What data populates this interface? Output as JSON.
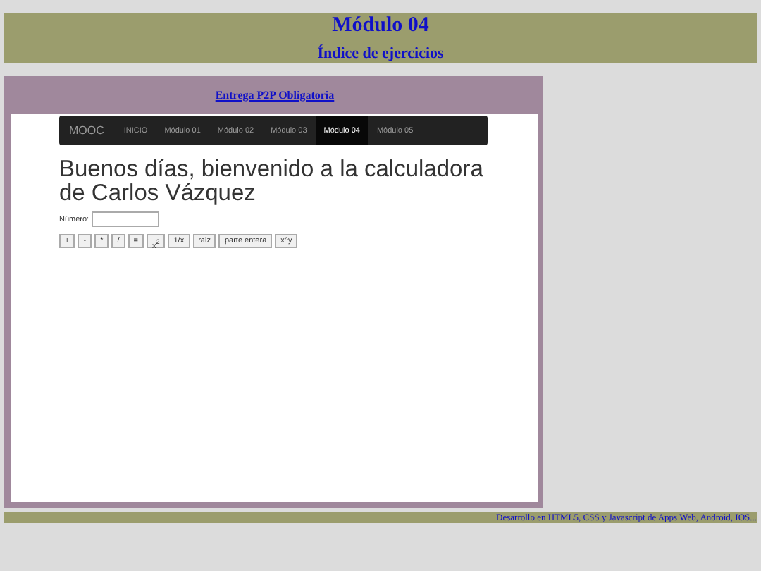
{
  "header": {
    "title": "Módulo 04",
    "subtitle": "Índice de ejercicios"
  },
  "panel": {
    "link": "Entrega P2P Obligatoria"
  },
  "navbar": {
    "brand": "MOOC",
    "items": [
      {
        "label": "INICIO",
        "selected": false
      },
      {
        "label": "Módulo 01",
        "selected": false
      },
      {
        "label": "Módulo 02",
        "selected": false
      },
      {
        "label": "Módulo 03",
        "selected": false
      },
      {
        "label": "Módulo 04",
        "selected": true
      },
      {
        "label": "Módulo 05",
        "selected": false
      }
    ]
  },
  "heading": "Buenos días, bienvenido a la calculadora de Carlos Vázquez",
  "field": {
    "label": "Número:"
  },
  "buttons": [
    "+",
    "-",
    "*",
    "/",
    "=",
    "x$^{2}$",
    "1/x",
    "raiz",
    "parte entera",
    "x^y"
  ],
  "footer": "Desarrollo en HTML5, CSS y Javascript de Apps Web, Android, IOS..."
}
